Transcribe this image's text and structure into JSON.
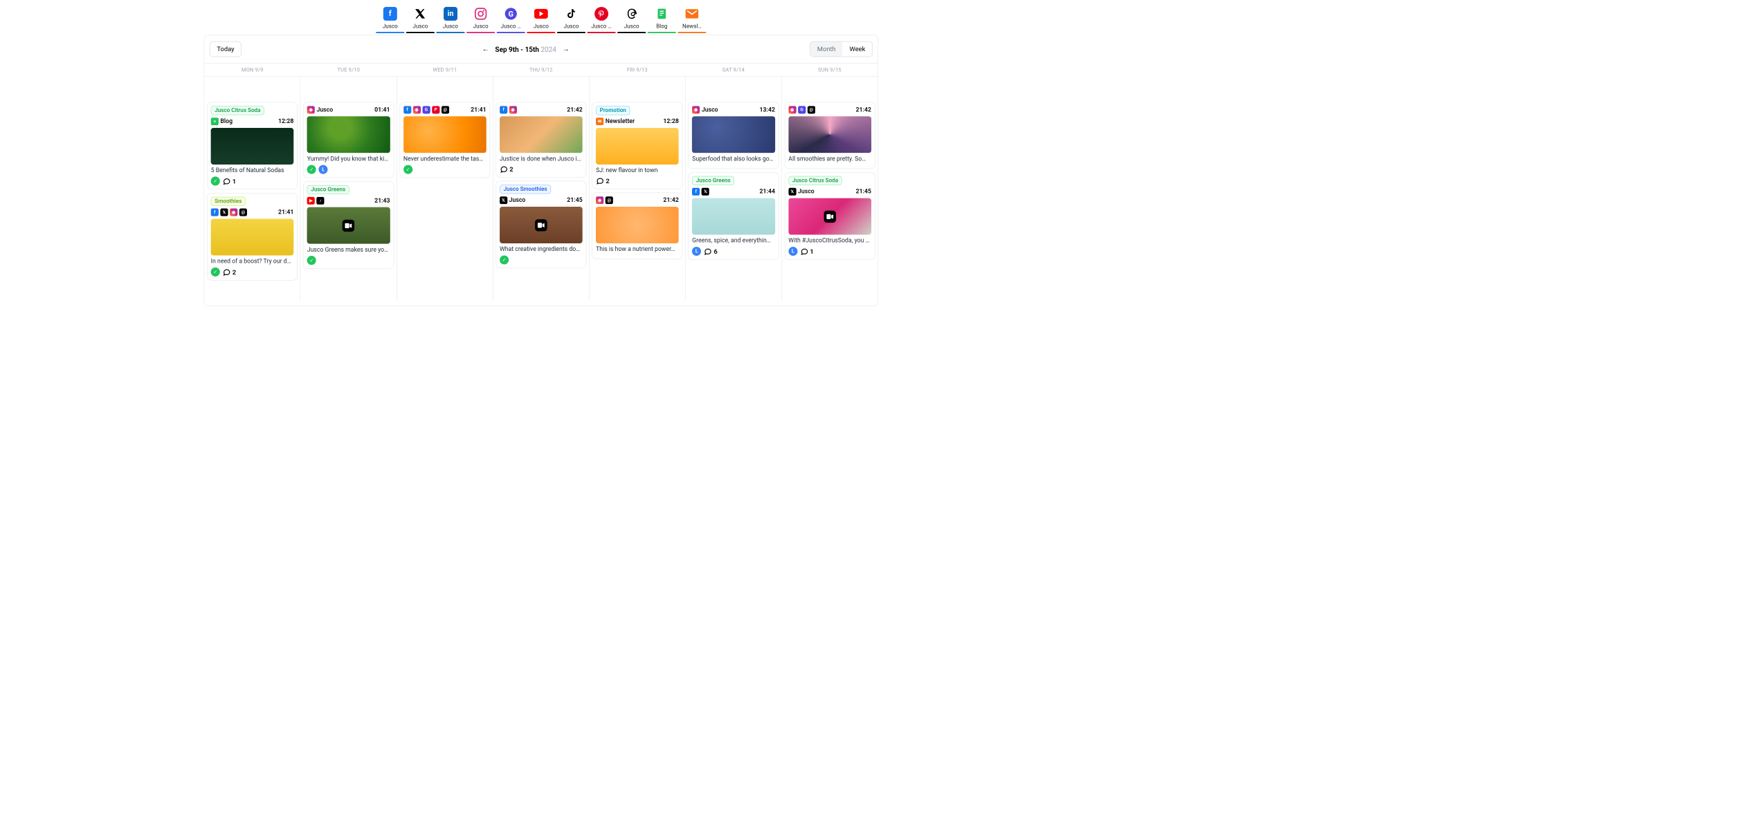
{
  "channels": [
    {
      "icon": "facebook",
      "label": "Jusco",
      "bar": "#1877f2"
    },
    {
      "icon": "x",
      "label": "Jusco",
      "bar": "#000000"
    },
    {
      "icon": "linkedin",
      "label": "Jusco",
      "bar": "#0a66c2"
    },
    {
      "icon": "instagram",
      "label": "Jusco",
      "bar": "#dd2a7b"
    },
    {
      "icon": "google",
      "label": "Jusco …",
      "bar": "#4f46e5"
    },
    {
      "icon": "youtube",
      "label": "Jusco",
      "bar": "#ff0000"
    },
    {
      "icon": "tiktok",
      "label": "Jusco",
      "bar": "#000000"
    },
    {
      "icon": "pinterest",
      "label": "Jusco …",
      "bar": "#e60023"
    },
    {
      "icon": "threads",
      "label": "Jusco",
      "bar": "#000000"
    },
    {
      "icon": "blog",
      "label": "Blog",
      "bar": "#22c55e"
    },
    {
      "icon": "newsletter",
      "label": "Newsl…",
      "bar": "#f97316"
    }
  ],
  "header": {
    "today": "Today",
    "range": {
      "main": "Sep 9th - 15th",
      "year": "2024"
    },
    "toggle": {
      "month": "Month",
      "week": "Week"
    }
  },
  "days": [
    "MON 9/9",
    "TUE 9/10",
    "WED 9/11",
    "THU 9/12",
    "FRI 9/13",
    "SAT 9/14",
    "SUN 9/15"
  ],
  "colors": {
    "tag_green": "#16a34a",
    "tag_teal": "#0891b2",
    "tag_lime": "#65a30d",
    "tag_blue": "#2563eb",
    "status_ok": "#22c55e",
    "status_sched": "#3b82f6"
  },
  "cards": {
    "mon": [
      {
        "tag": "Jusco Citrus Soda",
        "tag_cls": "tag-green",
        "channel_icon": "blog",
        "channel_label": "Blog",
        "time": "12:28",
        "thumb": "th-darkgreen",
        "title": "5 Benefits of Natural Sodas",
        "status": "ok",
        "comments": "1"
      },
      {
        "tag": "Smoothies",
        "tag_cls": "tag-lime",
        "channels": [
          "facebook",
          "x",
          "instagram",
          "threads"
        ],
        "time": "21:41",
        "thumb": "th-yellow",
        "caption": "In need of a boost? Try our d…",
        "status": "ok",
        "comments": "2"
      }
    ],
    "tue": [
      {
        "channels": [
          "instagram"
        ],
        "channel_label": "Jusco",
        "time": "01:41",
        "thumb": "th-kiwi",
        "caption": "Yummy! Did you know that ki…",
        "status_row": [
          "ok",
          "sched"
        ]
      },
      {
        "tag": "Jusco Greens",
        "tag_cls": "tag-green",
        "channels": [
          "youtube",
          "tiktok"
        ],
        "time": "21:43",
        "thumb": "th-avocado",
        "video": true,
        "caption": "Jusco Greens makes sure yo…",
        "status": "ok"
      }
    ],
    "wed": [
      {
        "channels": [
          "facebook",
          "instagram",
          "google",
          "pinterest",
          "threads"
        ],
        "time": "21:41",
        "thumb": "th-orange",
        "caption": "Never underestimate the tas…",
        "status": "ok"
      }
    ],
    "thu": [
      {
        "channels": [
          "facebook",
          "instagram"
        ],
        "time": "21:42",
        "thumb": "th-citrus",
        "caption": "Justice is done when Jusco i…",
        "comments": "2"
      },
      {
        "tag": "Jusco Smoothies",
        "tag_cls": "tag-blue",
        "channels": [
          "x"
        ],
        "channel_label": "Jusco",
        "time": "21:45",
        "thumb": "th-smoothies",
        "video": true,
        "caption": "What creative ingredients do…",
        "status": "ok"
      }
    ],
    "fri": [
      {
        "tag": "Promotion",
        "tag_cls": "tag-teal",
        "channel_icon": "newsletter",
        "channel_label": "Newsletter",
        "time": "12:28",
        "thumb": "th-juice",
        "title": "SJ: new flavour in town",
        "comments": "2"
      },
      {
        "channels": [
          "instagram",
          "threads"
        ],
        "time": "21:42",
        "thumb": "th-peach",
        "caption": "This is how a nutrient power…"
      }
    ],
    "sat": [
      {
        "channels": [
          "instagram"
        ],
        "channel_label": "Jusco",
        "time": "13:42",
        "thumb": "th-blueberry",
        "caption": "Superfood that also looks go…"
      },
      {
        "tag": "Jusco Greens",
        "tag_cls": "tag-green",
        "channels": [
          "facebook",
          "x"
        ],
        "time": "21:44",
        "thumb": "th-lime",
        "caption": "Greens, spice, and everythin…",
        "status": "sched",
        "comments": "6"
      }
    ],
    "sun": [
      {
        "channels": [
          "instagram",
          "google",
          "threads"
        ],
        "time": "21:42",
        "thumb": "th-bowl",
        "caption": "All smoothies are pretty. So…"
      },
      {
        "tag": "Jusco Citrus Soda",
        "tag_cls": "tag-green",
        "channels": [
          "x"
        ],
        "channel_label": "Jusco",
        "time": "21:45",
        "thumb": "th-pink",
        "video": true,
        "caption": "With #JuscoCitrusSoda, you …",
        "status": "sched",
        "comments": "1"
      }
    ]
  }
}
